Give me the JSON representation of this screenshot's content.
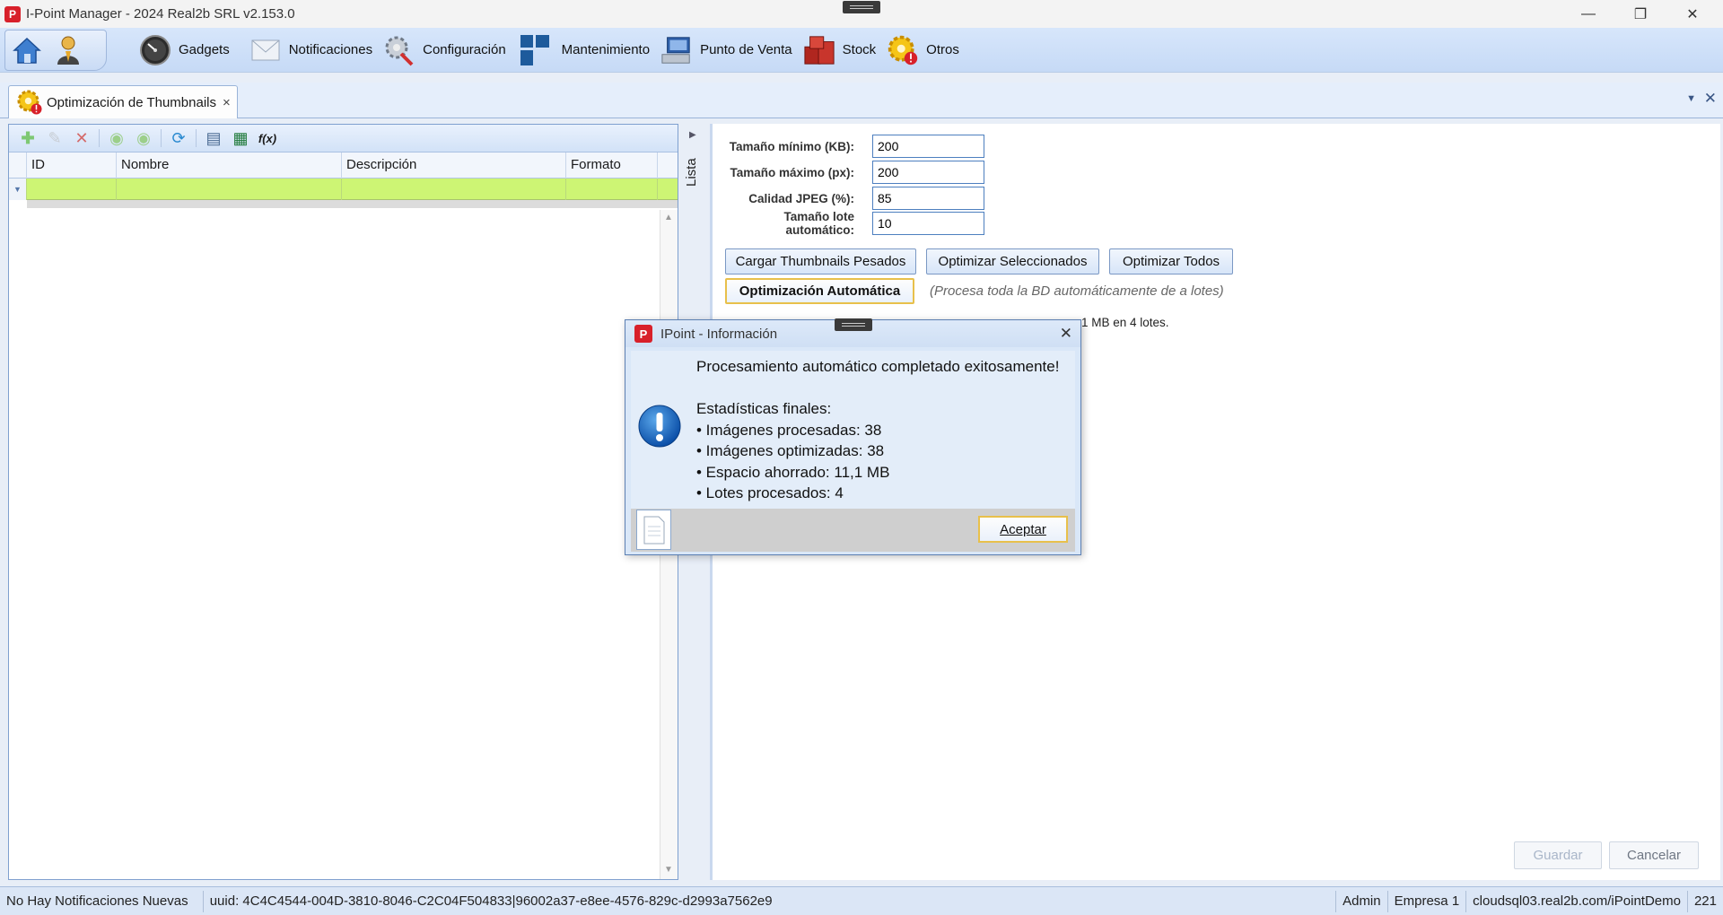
{
  "window": {
    "title": "I-Point Manager - 2024 Real2b SRL v2.153.0",
    "logo_letter": "P",
    "minimize": "—",
    "restore": "❐",
    "close": "✕"
  },
  "menubar": {
    "items": [
      {
        "label": "Gadgets",
        "icon": "gauge-icon"
      },
      {
        "label": "Notificaciones",
        "icon": "envelope-icon"
      },
      {
        "label": "Configuración",
        "icon": "wrench-gear-icon"
      },
      {
        "label": "Mantenimiento",
        "icon": "blocks-icon"
      },
      {
        "label": "Punto de Venta",
        "icon": "pos-terminal-icon"
      },
      {
        "label": "Stock",
        "icon": "boxes-icon"
      },
      {
        "label": "Otros",
        "icon": "gear-alert-icon"
      }
    ]
  },
  "doc_tab": {
    "label": "Optimización de Thumbnails",
    "close": "×"
  },
  "grid": {
    "columns": [
      "ID",
      "Nombre",
      "Descripción",
      "Formato"
    ]
  },
  "side_strip": {
    "label": "Lista"
  },
  "form": {
    "min_size_label": "Tamaño mínimo (KB):",
    "min_size_value": "200",
    "max_size_label": "Tamaño máximo (px):",
    "max_size_value": "200",
    "jpeg_quality_label": "Calidad JPEG (%):",
    "jpeg_quality_value": "85",
    "batch_size_label": "Tamaño lote automático:",
    "batch_size_value": "10"
  },
  "actions": {
    "load_heavy": "Cargar Thumbnails Pesados",
    "optimize_selected": "Optimizar Seleccionados",
    "optimize_all": "Optimizar Todos",
    "auto_optimize": "Optimización Automática",
    "auto_hint": "(Procesa toda la BD automáticamente de a lotes)",
    "result_visible": "1 MB en 4 lotes.",
    "save": "Guardar",
    "cancel": "Cancelar"
  },
  "statusbar": {
    "notifications": "No Hay Notificaciones Nuevas",
    "uuid": "uuid: 4C4C4544-004D-3810-8046-C2C04F504833|96002a37-e8ee-4576-829c-d2993a7562e9",
    "user": "Admin",
    "company": "Empresa 1",
    "server": "cloudsql03.real2b.com/iPointDemo",
    "extra": "221"
  },
  "dialog": {
    "title": "IPoint - Información",
    "message": "Procesamiento automático completado exitosamente!\n\nEstadísticas finales:\n• Imágenes procesadas: 38\n• Imágenes optimizadas: 38\n• Espacio ahorrado: 11,1 MB\n• Lotes procesados: 4",
    "ok": "Aceptar",
    "close": "✕"
  }
}
